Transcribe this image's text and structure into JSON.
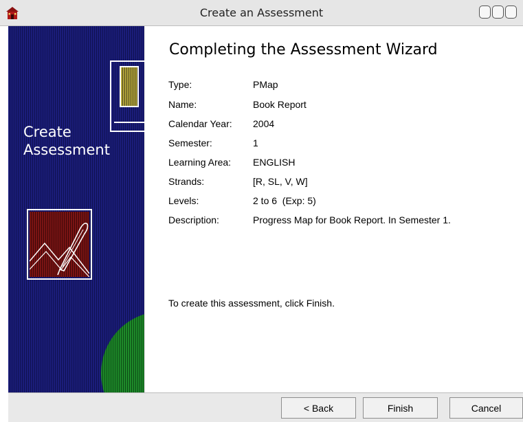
{
  "window": {
    "title": "Create an Assessment",
    "app_icon": "schoolhouse-icon"
  },
  "sidebar": {
    "title_line1": "Create",
    "title_line2": "Assessment",
    "art_icon": "quill-pen-icon"
  },
  "main": {
    "heading": "Completing the Assessment Wizard",
    "summary": [
      {
        "label": "Type:",
        "value": "PMap"
      },
      {
        "label": "Name:",
        "value": "Book Report"
      },
      {
        "label": "Calendar Year:",
        "value": "2004"
      },
      {
        "label": "Semester:",
        "value": "1"
      },
      {
        "label": "Learning Area:",
        "value": "ENGLISH"
      },
      {
        "label": "Strands:",
        "value": "[R, SL, V, W]"
      },
      {
        "label": "Levels:",
        "value": "2 to 6  (Exp: 5)"
      },
      {
        "label": "Description:",
        "value": "Progress Map for Book Report. In Semester 1."
      }
    ],
    "instruction": "To create this assessment, click Finish."
  },
  "buttons": {
    "back": "< Back",
    "finish": "Finish",
    "cancel": "Cancel"
  },
  "colors": {
    "sidebar_blue": "#1b1d7a",
    "art_red": "#7a1414",
    "art_gold": "#b4a63a",
    "art_green": "#1e8a2a"
  }
}
